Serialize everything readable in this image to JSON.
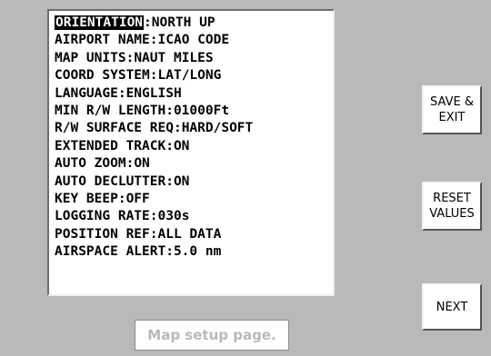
{
  "settings": [
    {
      "name": "ORIENTATION",
      "value": "NORTH UP"
    },
    {
      "name": "AIRPORT NAME",
      "value": "ICAO CODE"
    },
    {
      "name": "MAP UNITS",
      "value": "NAUT MILES"
    },
    {
      "name": "COORD SYSTEM",
      "value": "LAT/LONG"
    },
    {
      "name": "LANGUAGE",
      "value": "ENGLISH"
    },
    {
      "name": "MIN R/W LENGTH",
      "value": "01000Ft"
    },
    {
      "name": "R/W SURFACE REQ",
      "value": "HARD/SOFT"
    },
    {
      "name": "EXTENDED TRACK",
      "value": "ON"
    },
    {
      "name": "AUTO ZOOM",
      "value": "ON"
    },
    {
      "name": "AUTO DECLUTTER",
      "value": "ON"
    },
    {
      "name": "KEY BEEP",
      "value": "OFF"
    },
    {
      "name": "LOGGING RATE",
      "value": "030s"
    },
    {
      "name": "POSITION REF",
      "value": "ALL DATA"
    },
    {
      "name": "AIRSPACE ALERT",
      "value": "5.0 nm"
    }
  ],
  "separator": ":",
  "buttons": {
    "save_exit": "SAVE &\nEXIT",
    "reset_values": "RESET\nVALUES",
    "next": "NEXT"
  },
  "caption": "Map setup page.",
  "colors": {
    "background": "#b9b9b9",
    "panel": "#ffffff",
    "selected_bg": "#000000",
    "selected_text": "#ffffff"
  }
}
